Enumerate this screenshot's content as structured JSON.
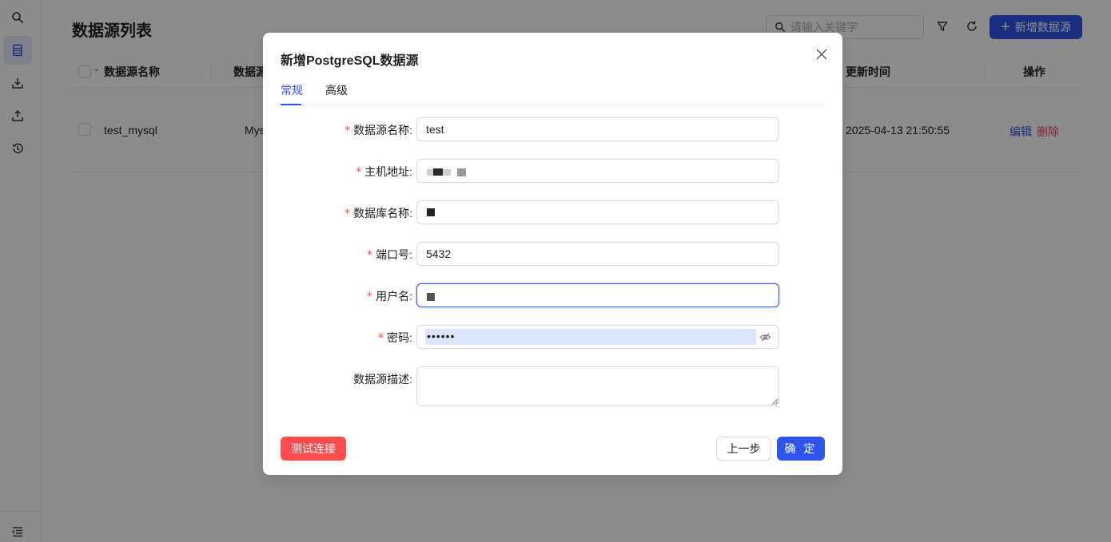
{
  "sidebar": {
    "icons": [
      "search-icon",
      "database-list-icon",
      "import-icon",
      "export-icon",
      "history-icon",
      "menu-collapse-icon"
    ]
  },
  "page": {
    "title": "数据源列表",
    "search_placeholder": "请输入关键字",
    "add_button_label": "新增数据源"
  },
  "table": {
    "columns": {
      "name": "数据源名称",
      "type": "数据源",
      "updated": "更新时间",
      "actions": "操作"
    },
    "rows": [
      {
        "name": "test_mysql",
        "type": "Mys",
        "updated": "2025-04-13 21:50:55",
        "edit": "编辑",
        "delete": "删除"
      }
    ]
  },
  "modal": {
    "title": "新增PostgreSQL数据源",
    "tabs": [
      {
        "label": "常规",
        "active": true
      },
      {
        "label": "高级",
        "active": false
      }
    ],
    "required_mark": "*",
    "fields": {
      "name": {
        "label": "数据源名称:",
        "value": "test"
      },
      "host": {
        "label": "主机地址:"
      },
      "database": {
        "label": "数据库名称:"
      },
      "port": {
        "label": "端口号:",
        "value": "5432"
      },
      "username": {
        "label": "用户名:"
      },
      "password": {
        "label": "密码:",
        "display": "••••••"
      },
      "description": {
        "label": "数据源描述:",
        "value": ""
      }
    },
    "buttons": {
      "test": "测试连接",
      "prev": "上一步",
      "ok": "确 定"
    }
  },
  "colors": {
    "primary": "#2f54eb",
    "danger": "#ff4d4f",
    "mask": "rgba(0,0,0,0.45)"
  }
}
